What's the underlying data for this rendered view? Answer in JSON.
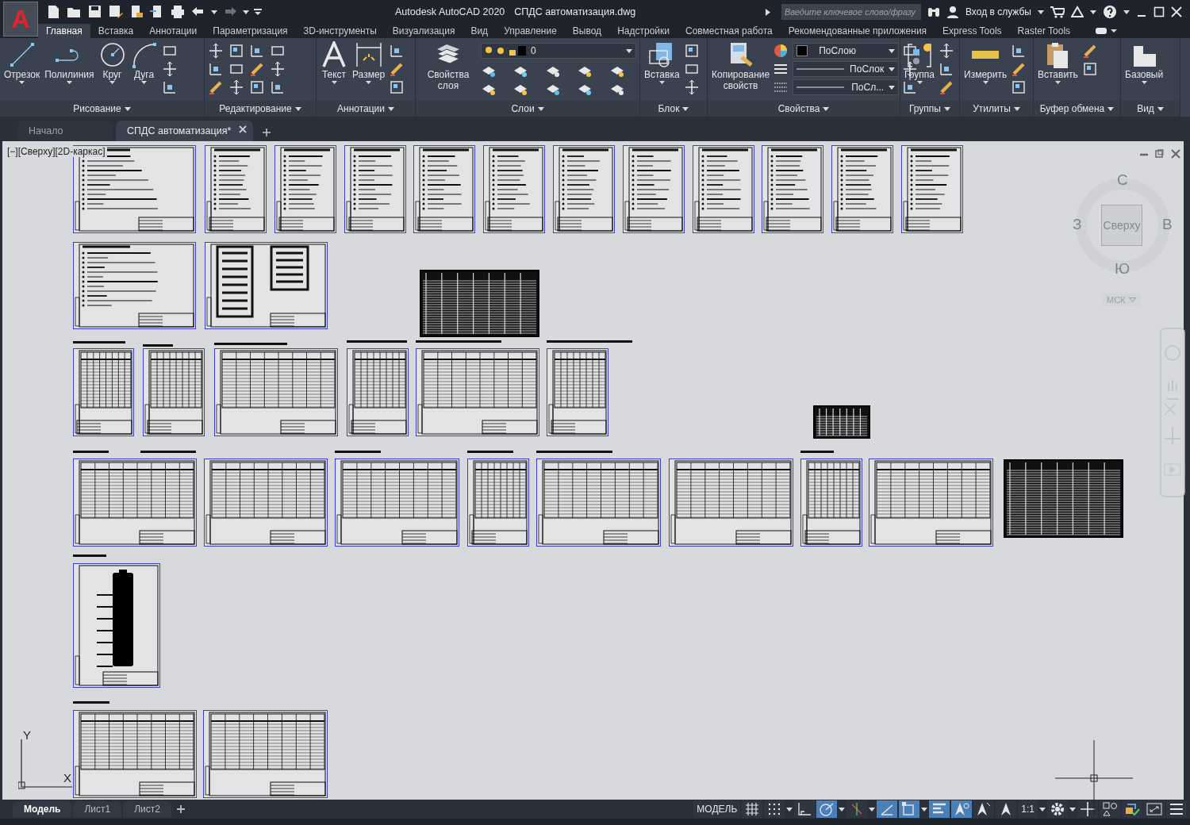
{
  "title_bar": {
    "app_letter": "A",
    "app_title": "Autodesk AutoCAD 2020",
    "document_title": "СПДС автоматизация.dwg",
    "search": {
      "placeholder": "Введите ключевое слово/фразу"
    },
    "sign_in": "Вход в службы"
  },
  "ribbon_tabs": [
    {
      "label": "Главная",
      "selected": true
    },
    {
      "label": "Вставка",
      "selected": false
    },
    {
      "label": "Аннотации",
      "selected": false
    },
    {
      "label": "Параметризация",
      "selected": false
    },
    {
      "label": "3D-инструменты",
      "selected": false
    },
    {
      "label": "Визуализация",
      "selected": false
    },
    {
      "label": "Вид",
      "selected": false
    },
    {
      "label": "Управление",
      "selected": false
    },
    {
      "label": "Вывод",
      "selected": false
    },
    {
      "label": "Надстройки",
      "selected": false
    },
    {
      "label": "Совместная работа",
      "selected": false
    },
    {
      "label": "Рекомендованные приложения",
      "selected": false
    },
    {
      "label": "Express Tools",
      "selected": false
    },
    {
      "label": "Raster Tools",
      "selected": false
    }
  ],
  "panels": [
    {
      "title": "Рисование",
      "tools": [
        {
          "label": "Отрезок"
        },
        {
          "label": "Полилиния"
        },
        {
          "label": "Круг"
        },
        {
          "label": "Дуга"
        }
      ]
    },
    {
      "title": "Редактирование"
    },
    {
      "title": "Аннотации",
      "tools": [
        {
          "label": "Текст"
        },
        {
          "label": "Размер"
        }
      ]
    },
    {
      "title": "Слои",
      "tools": [
        {
          "label": "Свойства слоя"
        }
      ],
      "layer": "0"
    },
    {
      "title": "Блок",
      "tools": [
        {
          "label": "Вставка"
        }
      ]
    },
    {
      "title": "Свойства",
      "tools": [
        {
          "label": "Копирование свойств"
        }
      ],
      "dropdowns": [
        "ПоСлою",
        "ПоСлок",
        "ПоСл..."
      ]
    },
    {
      "title": "Группы",
      "tools": [
        {
          "label": "Группа"
        }
      ]
    },
    {
      "title": "Утилиты",
      "tools": [
        {
          "label": "Измерить"
        }
      ]
    },
    {
      "title": "Буфер обмена",
      "tools": [
        {
          "label": "Вставить"
        }
      ]
    },
    {
      "title": "Вид",
      "tools": [
        {
          "label": "Базовый"
        }
      ]
    }
  ],
  "document_tabs": [
    {
      "label": "Начало",
      "selected": false
    },
    {
      "label": "СПДС автоматизация*",
      "selected": true
    }
  ],
  "viewport": {
    "label": "[−][Сверху][2D-каркас]",
    "viewcube": {
      "north": "С",
      "west": "З",
      "face": "Сверху",
      "east": "В",
      "south": "Ю",
      "ucs": "МСК"
    },
    "ucs_icon": {
      "y": "Y",
      "x": "X"
    }
  },
  "layout_tabs": [
    {
      "label": "Модель",
      "selected": true
    },
    {
      "label": "Лист1",
      "selected": false
    },
    {
      "label": "Лист2",
      "selected": false
    }
  ],
  "status_bar": [
    {
      "kind": "text",
      "label": "МОДЕЛЬ"
    },
    {
      "kind": "grid",
      "on": false
    },
    {
      "kind": "snap",
      "on": false
    },
    {
      "kind": "ortho",
      "on": false
    },
    {
      "kind": "polar",
      "on": true
    },
    {
      "kind": "isodraft",
      "on": false
    },
    {
      "kind": "otrack",
      "on": true
    },
    {
      "kind": "osnap",
      "on": true
    },
    {
      "kind": "lineweight",
      "on": true
    },
    {
      "kind": "annovis",
      "on": true
    },
    {
      "kind": "autoscale",
      "on": false
    },
    {
      "kind": "annoscale",
      "on": false
    },
    {
      "kind": "text",
      "label": "1:1"
    },
    {
      "kind": "workspace",
      "on": false
    },
    {
      "kind": "plus",
      "on": false
    },
    {
      "kind": "isolate",
      "on": false
    },
    {
      "kind": "hardware",
      "on": false
    },
    {
      "kind": "fullscreen",
      "on": false
    },
    {
      "kind": "menu",
      "on": false
    }
  ]
}
